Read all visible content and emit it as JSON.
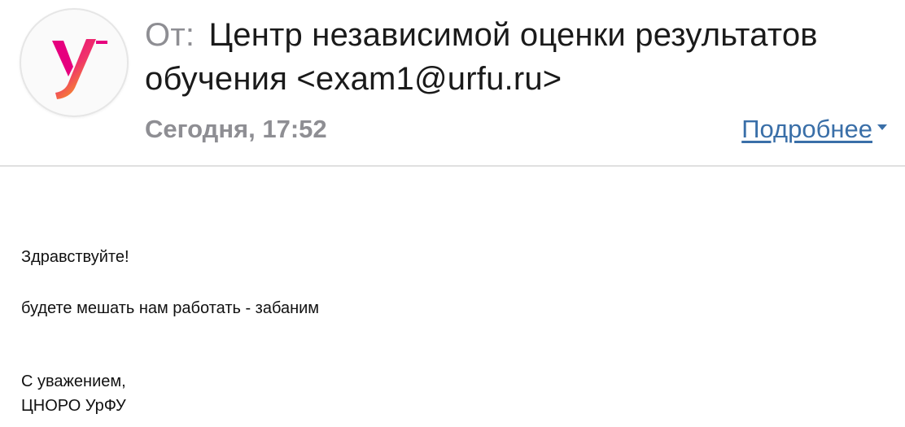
{
  "header": {
    "from_label": "От:",
    "sender": "Центр независимой оценки результатов обучения <exam1@urfu.ru>",
    "date": "Сегодня, 17:52",
    "details_link": "Подробнее",
    "avatar_icon": "urfu-logo-icon"
  },
  "colors": {
    "link": "#3a6fa8",
    "secondary_text": "#8e8e93",
    "logo_gradient": [
      "#e6007e",
      "#f7941d"
    ]
  },
  "body": {
    "greeting": "Здравствуйте!",
    "message": "будете мешать нам работать - забаним",
    "regards": "С уважением,",
    "signature": "ЦНОРО УрФУ"
  }
}
